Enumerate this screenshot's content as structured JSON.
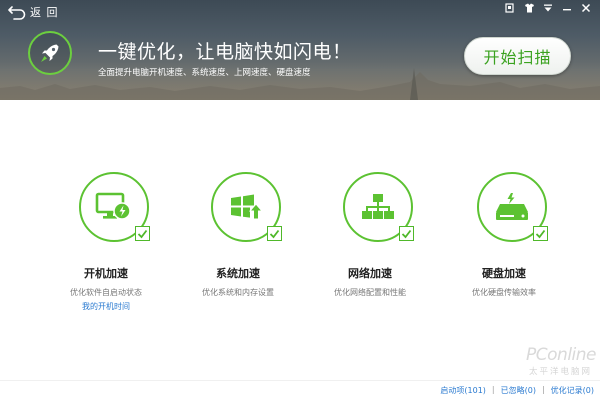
{
  "header": {
    "back_label": "返 回",
    "headline": "一键优化，让电脑快如闪电！",
    "subline": "全面提升电脑开机速度、系统速度、上网速度、硬盘速度",
    "scan_button": "开始扫描",
    "window_controls": [
      "skin-icon",
      "shirt-icon",
      "menu-arrow-icon",
      "minimize-icon",
      "close-icon"
    ]
  },
  "features": [
    {
      "title": "开机加速",
      "desc": "优化软件自启动状态",
      "link": "我的开机时间",
      "icon": "monitor-power-icon"
    },
    {
      "title": "系统加速",
      "desc": "优化系统和内存设置",
      "icon": "windows-up-icon"
    },
    {
      "title": "网络加速",
      "desc": "优化网络配置和性能",
      "icon": "network-icon"
    },
    {
      "title": "硬盘加速",
      "desc": "优化硬盘传输效率",
      "icon": "harddisk-icon"
    }
  ],
  "footer": {
    "links": [
      "启动项(101)",
      "已忽略(0)",
      "优化记录(0)"
    ],
    "separator": "|"
  },
  "watermark": {
    "main": "PConline",
    "sub": "太平洋电脑网"
  },
  "colors": {
    "accent_green": "#5cc232",
    "link_blue": "#2a7ad0",
    "header_dark": "#3d4a55"
  }
}
